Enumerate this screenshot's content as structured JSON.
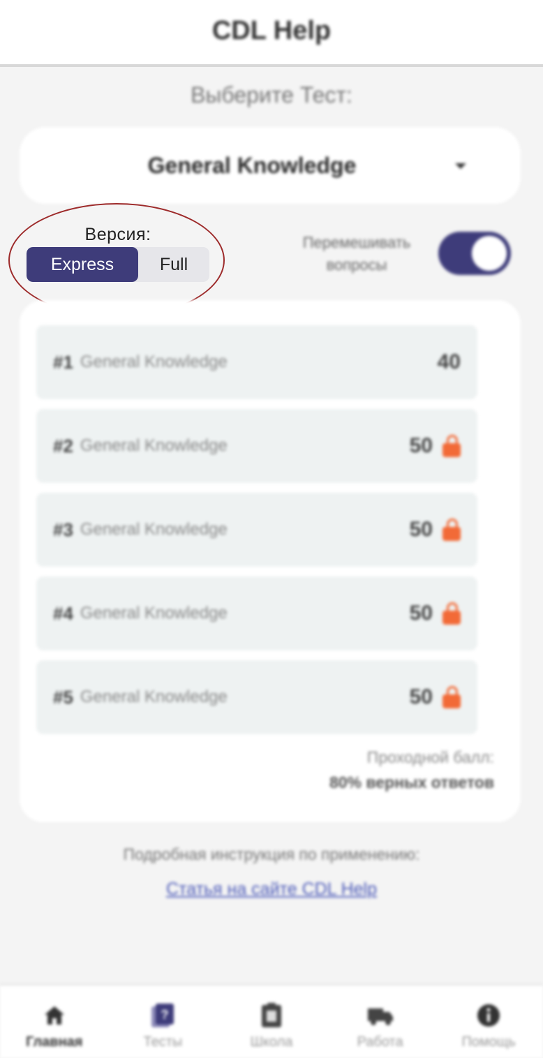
{
  "header": {
    "title": "CDL Help"
  },
  "test_selector": {
    "label": "Выберите Тест:",
    "selected": "General Knowledge"
  },
  "version": {
    "label": "Версия:",
    "options": [
      "Express",
      "Full"
    ],
    "selected": "Express"
  },
  "shuffle": {
    "label_line1": "Перемешивать",
    "label_line2": "вопросы",
    "enabled": true
  },
  "tests": [
    {
      "num": "#1",
      "name": "General Knowledge",
      "count": "40",
      "locked": false
    },
    {
      "num": "#2",
      "name": "General Knowledge",
      "count": "50",
      "locked": true
    },
    {
      "num": "#3",
      "name": "General Knowledge",
      "count": "50",
      "locked": true
    },
    {
      "num": "#4",
      "name": "General Knowledge",
      "count": "50",
      "locked": true
    },
    {
      "num": "#5",
      "name": "General Knowledge",
      "count": "50",
      "locked": true
    }
  ],
  "passing": {
    "label": "Проходной балл:",
    "value": "80% верных ответов"
  },
  "instructions": {
    "label": "Подробная инструкция по применению:",
    "link": "Статья на сайте CDL Help"
  },
  "tabs": [
    {
      "label": "Главная",
      "icon": "home-icon",
      "active": true
    },
    {
      "label": "Тесты",
      "icon": "tests-icon",
      "active": false
    },
    {
      "label": "Школа",
      "icon": "school-icon",
      "active": false
    },
    {
      "label": "Работа",
      "icon": "truck-icon",
      "active": false
    },
    {
      "label": "Помощь",
      "icon": "info-icon",
      "active": false
    }
  ],
  "colors": {
    "accent": "#3e3c7a",
    "lock": "#f26a37",
    "link": "#4b59b8",
    "highlight_ellipse": "#9d2a2a"
  }
}
